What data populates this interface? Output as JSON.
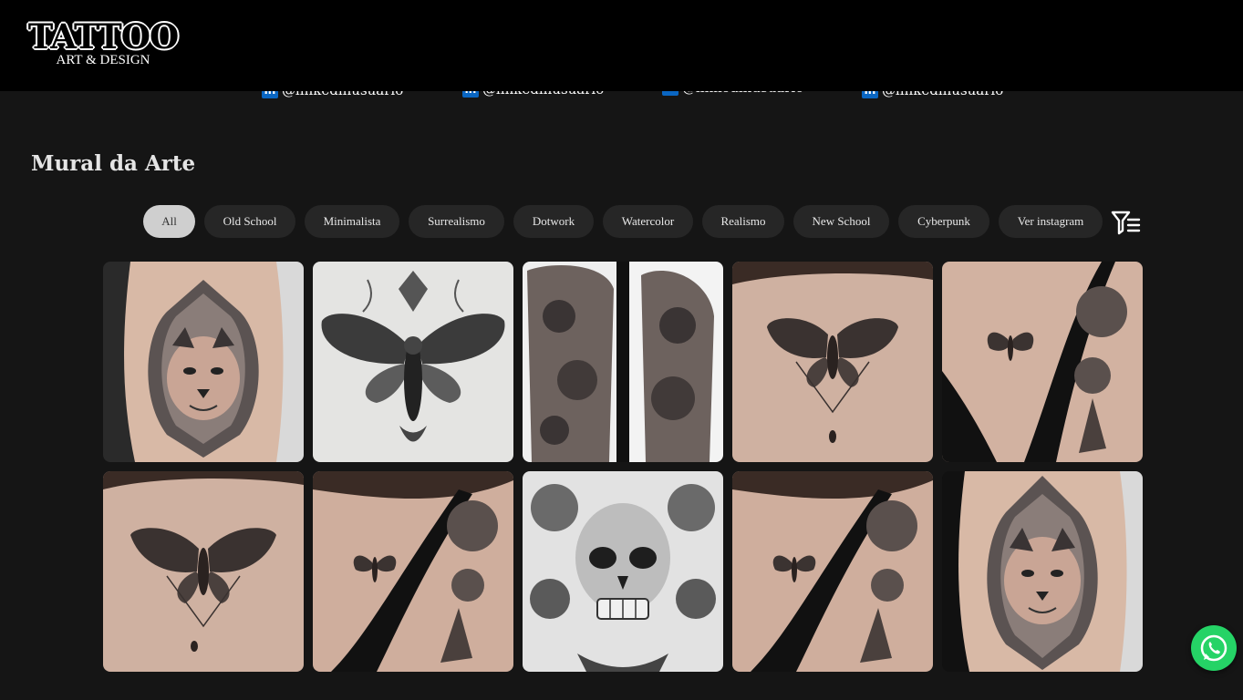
{
  "header": {
    "logo_title": "TATTOO",
    "logo_subtitle": "ART & DESIGN"
  },
  "social": {
    "icon": "linkedin-icon",
    "icon_glyph": "in",
    "handles": [
      "@linkedinusuario",
      "@linkedinusuario",
      "@linkedinusuario",
      "@linkedinusuario"
    ]
  },
  "gallery_section": {
    "title": "Mural da Arte"
  },
  "filters": {
    "active": "All",
    "chips": [
      "All",
      "Old School",
      "Minimalista",
      "Surrealismo",
      "Dotwork",
      "Watercolor",
      "Realismo",
      "New School",
      "Cyberpunk",
      "Ver instagram"
    ],
    "filter_icon": "filter-list-icon"
  },
  "gallery": {
    "tiles": [
      {
        "subject": "panther-mandala-tattoo"
      },
      {
        "subject": "moth-sketch-drawing"
      },
      {
        "subject": "floral-sleeve-tattoo"
      },
      {
        "subject": "moth-back-tattoo"
      },
      {
        "subject": "butterfly-roses-shoulder-tattoo"
      },
      {
        "subject": "moth-back-tattoo"
      },
      {
        "subject": "butterfly-roses-shoulder-tattoo"
      },
      {
        "subject": "skull-ornament-drawing"
      },
      {
        "subject": "butterfly-roses-shoulder-tattoo"
      },
      {
        "subject": "panther-mandala-tattoo"
      }
    ]
  },
  "floating": {
    "whatsapp_icon": "whatsapp-icon",
    "whatsapp_color": "#25d366"
  },
  "colors": {
    "background": "#151515",
    "header": "#000000",
    "chip": "#262626",
    "chip_active": "#cfcfcf",
    "linkedin": "#0a66c2"
  }
}
